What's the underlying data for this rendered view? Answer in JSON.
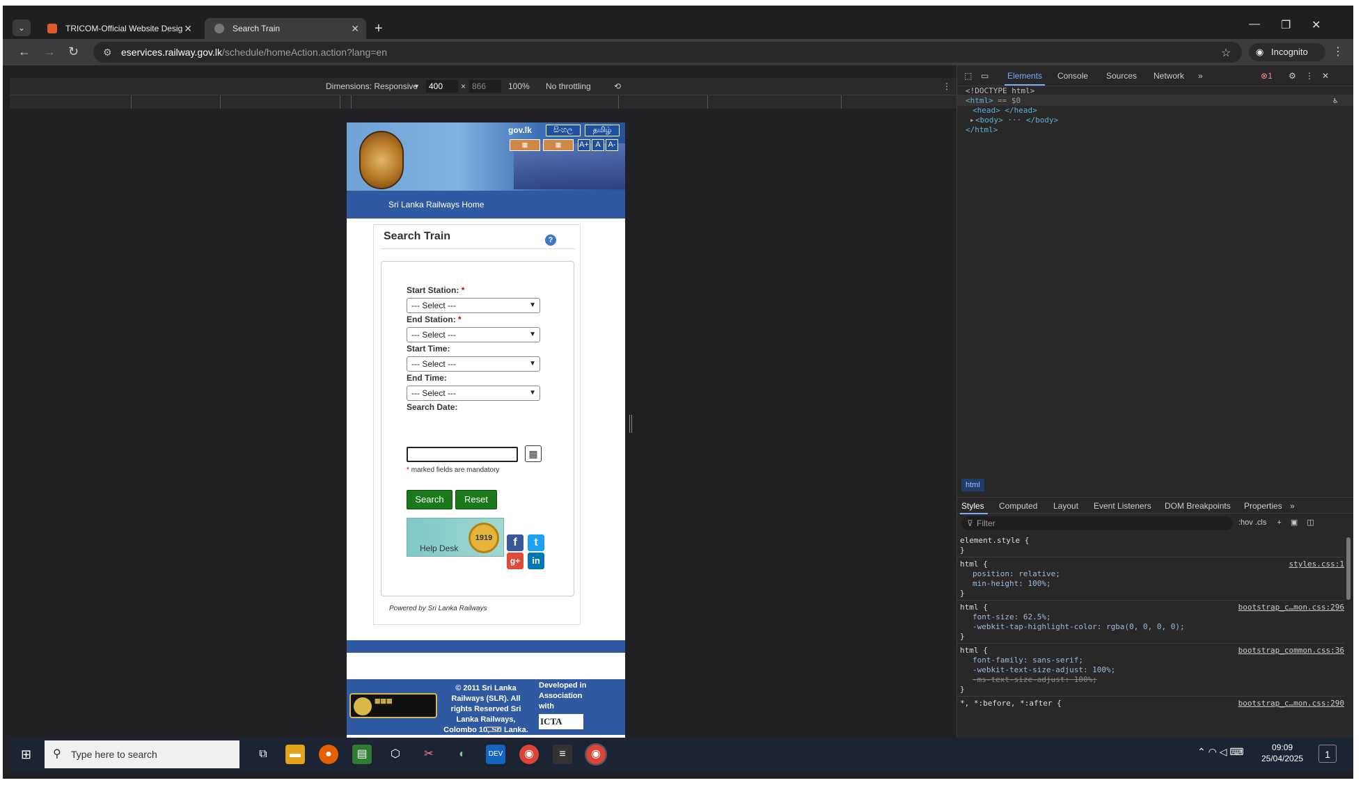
{
  "browser": {
    "tabs": [
      {
        "label": "TRICOM-Official Website Desig"
      },
      {
        "label": "Search Train"
      }
    ],
    "url_host": "eservices.railway.gov.lk",
    "url_path": "/schedule/homeAction.action?lang=en",
    "incognito_label": "Incognito"
  },
  "device_toolbar": {
    "dimensions_label": "Dimensions: Responsive",
    "width": "400",
    "height": "866",
    "zoom": "100%",
    "throttling": "No throttling"
  },
  "site": {
    "govlk": "gov.lk",
    "lang_sinhala": "සිංහල",
    "lang_tamil": "தமிழ்",
    "font_sizes": [
      "A+",
      "A",
      "A-"
    ],
    "nav_home": "Sri Lanka Railways Home",
    "form_title": "Search Train",
    "help_icon": "?",
    "start_station_label": "Start Station:",
    "end_station_label": "End Station:",
    "start_time_label": "Start Time:",
    "end_time_label": "End Time:",
    "search_date_label": "Search Date:",
    "required_mark": "*",
    "select_placeholder": "--- Select ---",
    "mandatory_note": "marked fields are mandatory",
    "search_button": "Search",
    "reset_button": "Reset",
    "helpdesk_number": "1919",
    "helpdesk_label": "Help Desk",
    "powered_by": "Powered by Sri Lanka Railways",
    "footer_copy": "© 2011 Sri Lanka Railways (SLR). All rights Reserved Sri Lanka Railways, Colombo 10, Sri Lanka.",
    "footer_dev": "Developed in Association with",
    "footer_icta": "ICTA"
  },
  "devtools": {
    "tabs": [
      "Elements",
      "Console",
      "Sources",
      "Network"
    ],
    "error_count": "1",
    "dom": {
      "doctype": "<!DOCTYPE html>",
      "html_open": "<html>",
      "html_sel": "== $0",
      "head": "<head> </head>",
      "body": "<body> ··· </body>",
      "html_close": "</html>"
    },
    "breadcrumb": "html",
    "style_tabs": [
      "Styles",
      "Computed",
      "Layout",
      "Event Listeners",
      "DOM Breakpoints",
      "Properties"
    ],
    "filter_placeholder": "Filter",
    "filter_tools": ":hov  .cls",
    "rules": {
      "r0_sel": "element.style {",
      "r1_sel": "html {",
      "r1_src": "styles.css:1",
      "r1_p1": "position: relative;",
      "r1_p2": "min-height: 100%;",
      "r2_sel": "html {",
      "r2_src": "bootstrap_c…mon.css:296",
      "r2_p1": "font-size: 62.5%;",
      "r2_p2": "-webkit-tap-highlight-color: rgba(0, 0, 0, 0);",
      "r3_sel": "html {",
      "r3_src": "bootstrap_common.css:36",
      "r3_p1": "font-family: sans-serif;",
      "r3_p2": "-webkit-text-size-adjust: 100%;",
      "r3_p3": "-ms-text-size-adjust: 100%;",
      "r4_sel": "*, *:before, *:after {",
      "r4_src": "bootstrap_c…mon.css:290",
      "close": "}"
    }
  },
  "taskbar": {
    "search_placeholder": "Type here to search",
    "time": "09:09",
    "date": "25/04/2025",
    "notif": "1"
  }
}
